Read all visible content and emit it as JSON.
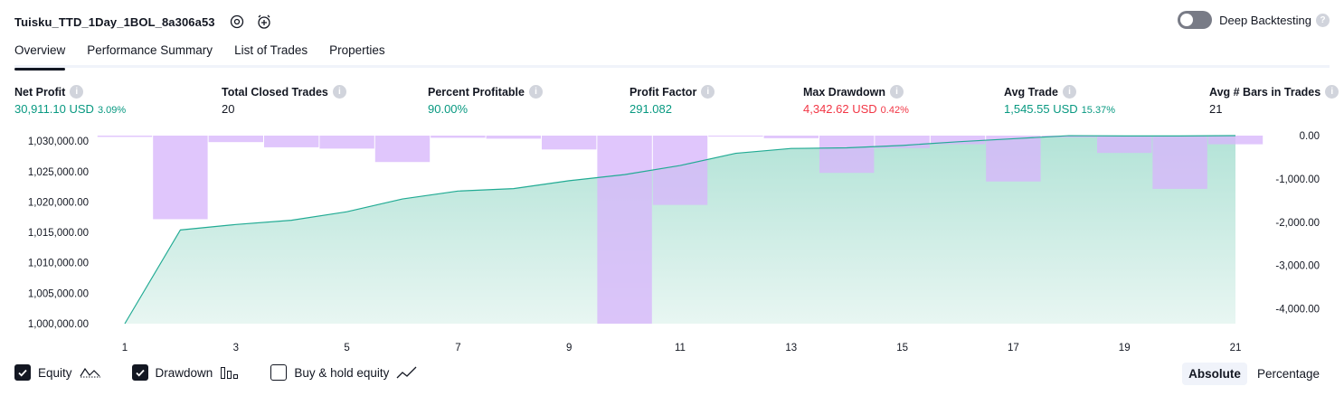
{
  "header": {
    "strategy_name": "Tuisku_TTD_1Day_1BOL_8a306a53",
    "icons": [
      "settings-icon",
      "add-alert-icon"
    ]
  },
  "deep_backtesting": {
    "label": "Deep Backtesting",
    "enabled": false,
    "help": "?"
  },
  "tabs": [
    {
      "label": "Overview",
      "active": true
    },
    {
      "label": "Performance Summary",
      "active": false
    },
    {
      "label": "List of Trades",
      "active": false
    },
    {
      "label": "Properties",
      "active": false
    }
  ],
  "metrics": {
    "net_profit": {
      "label": "Net Profit",
      "value": "30,911.10 USD",
      "pct": "3.09%"
    },
    "total_closed_trades": {
      "label": "Total Closed Trades",
      "value": "20"
    },
    "percent_profitable": {
      "label": "Percent Profitable",
      "value": "90.00%"
    },
    "profit_factor": {
      "label": "Profit Factor",
      "value": "291.082"
    },
    "max_drawdown": {
      "label": "Max Drawdown",
      "value": "4,342.62 USD",
      "pct": "0.42%"
    },
    "avg_trade": {
      "label": "Avg Trade",
      "value": "1,545.55 USD",
      "pct": "15.37%"
    },
    "avg_bars": {
      "label": "Avg # Bars in Trades",
      "value": "21"
    }
  },
  "colors": {
    "equity_line": "#22ab94",
    "equity_fill_top": "#b3e3d7",
    "equity_fill_bottom": "#e8f6f2",
    "drawdown_bar": "#d7b6fb",
    "drawdown_bar_over_equity": "#b4aee9",
    "positive": "#089981",
    "negative": "#f23645"
  },
  "chart_data": {
    "type": "area",
    "x_ticks": [
      1,
      3,
      5,
      7,
      9,
      11,
      13,
      15,
      17,
      19,
      21
    ],
    "left_axis": {
      "ticks": [
        "1,030,000.00",
        "1,025,000.00",
        "1,020,000.00",
        "1,015,000.00",
        "1,010,000.00",
        "1,005,000.00",
        "1,000,000.00"
      ],
      "ylim": [
        1000000,
        1030911.1
      ]
    },
    "right_axis": {
      "ticks": [
        "0.00",
        "-1,000.00",
        "-2,000.00",
        "-3,000.00",
        "-4,000.00"
      ],
      "ylim": [
        -4342.62,
        0
      ]
    },
    "series": [
      {
        "name": "Equity",
        "x": [
          1,
          2,
          3,
          4,
          5,
          6,
          7,
          8,
          9,
          10,
          11,
          12,
          13,
          14,
          15,
          16,
          17,
          18,
          19,
          20,
          21
        ],
        "values": [
          1000000,
          1015400,
          1016300,
          1017000,
          1018400,
          1020500,
          1021800,
          1022200,
          1023500,
          1024500,
          1026000,
          1028000,
          1028800,
          1028900,
          1029300,
          1029900,
          1030400,
          1030900,
          1030850,
          1030850,
          1030911.1
        ]
      },
      {
        "name": "Drawdown",
        "x": [
          1,
          2,
          3,
          4,
          5,
          6,
          7,
          8,
          9,
          10,
          11,
          12,
          13,
          14,
          15,
          16,
          17,
          18,
          19,
          20,
          21
        ],
        "values": [
          -30,
          -1930,
          -150,
          -270,
          -300,
          -610,
          -50,
          -70,
          -320,
          -4342.62,
          -1600,
          -20,
          -60,
          -860,
          -290,
          -200,
          -1060,
          -40,
          -400,
          -1230,
          -200
        ]
      }
    ],
    "grid": false
  },
  "legend": [
    {
      "label": "Equity",
      "checked": true,
      "icon": "equity-line-icon"
    },
    {
      "label": "Drawdown",
      "checked": true,
      "icon": "drawdown-bars-icon"
    },
    {
      "label": "Buy & hold equity",
      "checked": false,
      "icon": "buy-hold-line-icon"
    }
  ],
  "mode": [
    {
      "label": "Absolute",
      "active": true
    },
    {
      "label": "Percentage",
      "active": false
    }
  ]
}
